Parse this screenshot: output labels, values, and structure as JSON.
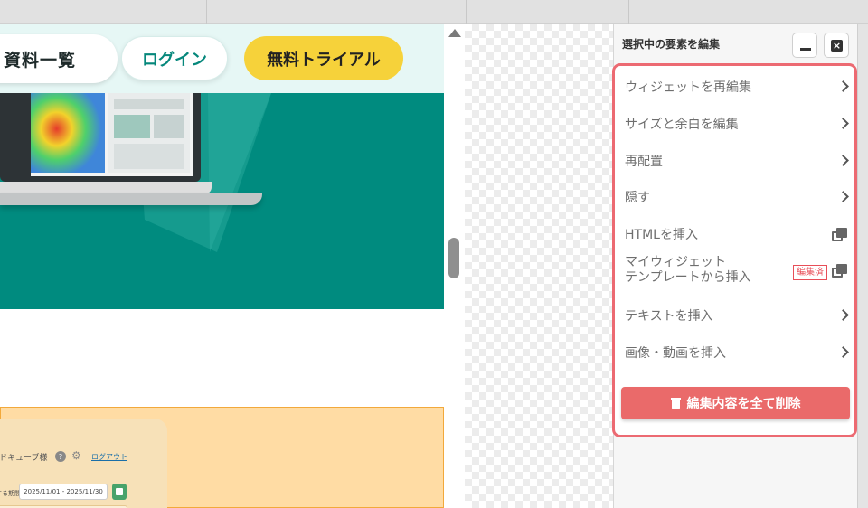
{
  "preview": {
    "nav_docs": "資料一覧",
    "login_label": "ログイン",
    "trial_label": "無料トライアル",
    "mock_user": "ラッドキューブ様",
    "mock_help": "?",
    "mock_logout": "ログアウト",
    "mock_period_label": "表示する期間",
    "mock_period_value": "2025/11/01 - 2025/11/30"
  },
  "panel": {
    "title": "選択中の要素を編集",
    "close_glyph": "×",
    "items": [
      {
        "label": "ウィジェットを再編集"
      },
      {
        "label": "サイズと余白を編集"
      },
      {
        "label": "再配置"
      },
      {
        "label": "隠す"
      },
      {
        "label": "HTMLを挿入"
      },
      {
        "label_line1": "マイウィジェット",
        "label_line2": "テンプレートから挿入",
        "badge": "編集済"
      },
      {
        "label": "テキストを挿入"
      },
      {
        "label": "画像・動画を挿入"
      }
    ],
    "delete_label": "編集内容を全て削除"
  },
  "colors": {
    "accent": "#ec6a72",
    "delete_button": "#ea6a6a",
    "hero_teal": "#008b7f",
    "trial_yellow": "#f6d23a",
    "login_text": "#05877b"
  }
}
